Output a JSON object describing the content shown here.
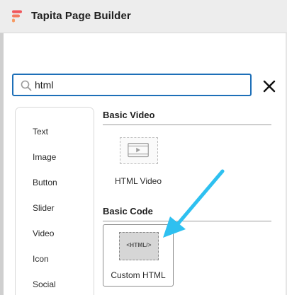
{
  "header": {
    "title": "Tapita Page Builder",
    "logo_icon": "tapita-logo-icon",
    "logo_color": "#f0565b"
  },
  "search": {
    "value": "html",
    "icon": "search-icon",
    "border_color": "#1d6fb8"
  },
  "close_button": {
    "icon": "close-icon"
  },
  "categories": {
    "items": [
      {
        "label": "Text"
      },
      {
        "label": "Image"
      },
      {
        "label": "Button"
      },
      {
        "label": "Slider"
      },
      {
        "label": "Video"
      },
      {
        "label": "Icon"
      },
      {
        "label": "Social"
      }
    ]
  },
  "sections": [
    {
      "title": "Basic Video",
      "widgets": [
        {
          "label": "HTML Video",
          "icon": "video-player-icon"
        }
      ]
    },
    {
      "title": "Basic Code",
      "widgets": [
        {
          "label": "Custom HTML",
          "icon": "html-code-icon",
          "thumb_text": "<HTML/>"
        }
      ]
    }
  ],
  "annotation": {
    "icon": "arrow-pointer-icon",
    "color": "#2ec0f0"
  }
}
